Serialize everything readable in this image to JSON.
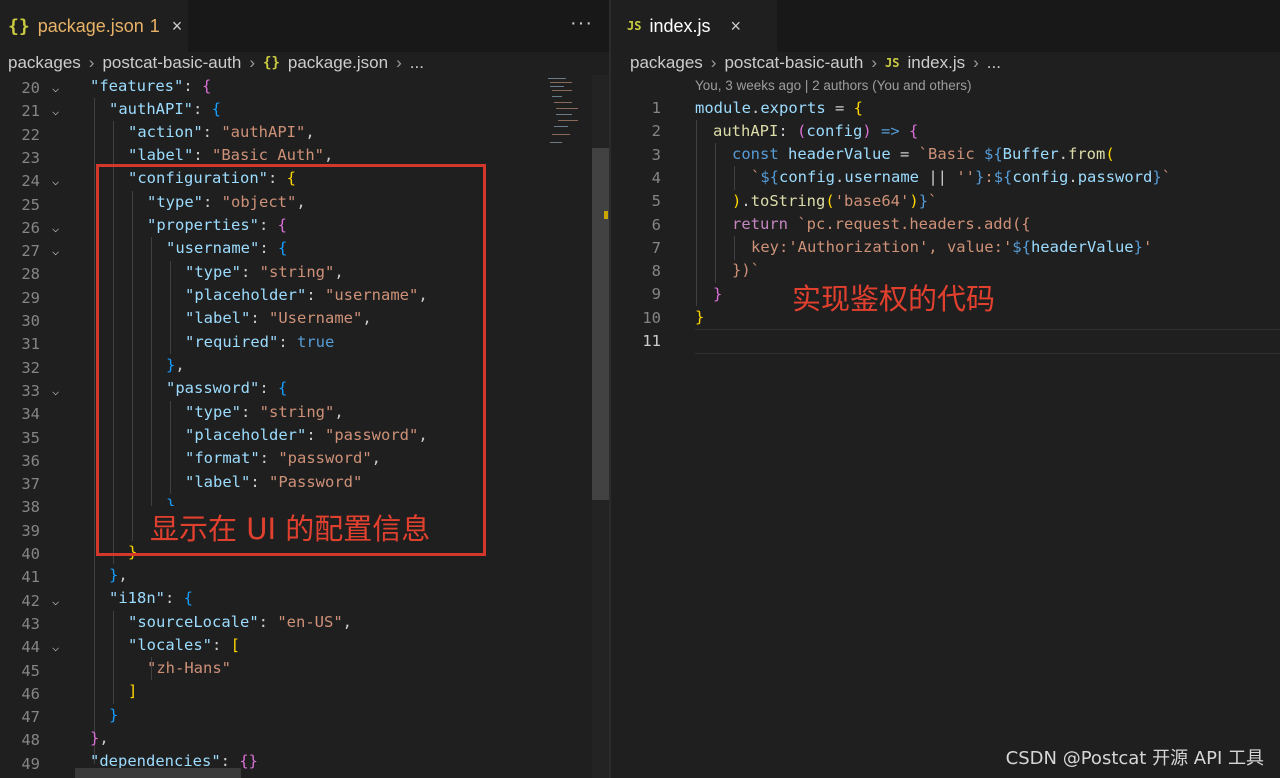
{
  "left_editor": {
    "tab": {
      "icon": "{}",
      "label": "package.json",
      "badge": "1",
      "close": "×"
    },
    "tab_actions": "···",
    "breadcrumb": [
      "packages",
      "postcat-basic-auth",
      "package.json",
      "..."
    ],
    "breadcrumb_file_icon": "{}",
    "lines": [
      {
        "num": "20",
        "fold": true
      },
      {
        "num": "21",
        "fold": true
      },
      {
        "num": "22",
        "fold": false
      },
      {
        "num": "23",
        "fold": false
      },
      {
        "num": "24",
        "fold": true
      },
      {
        "num": "25",
        "fold": false
      },
      {
        "num": "26",
        "fold": true
      },
      {
        "num": "27",
        "fold": true
      },
      {
        "num": "28",
        "fold": false
      },
      {
        "num": "29",
        "fold": false
      },
      {
        "num": "30",
        "fold": false
      },
      {
        "num": "31",
        "fold": false
      },
      {
        "num": "32",
        "fold": false
      },
      {
        "num": "33",
        "fold": true
      },
      {
        "num": "34",
        "fold": false
      },
      {
        "num": "35",
        "fold": false
      },
      {
        "num": "36",
        "fold": false
      },
      {
        "num": "37",
        "fold": false
      },
      {
        "num": "38",
        "fold": false
      },
      {
        "num": "39",
        "fold": false
      },
      {
        "num": "40",
        "fold": false
      },
      {
        "num": "41",
        "fold": false
      },
      {
        "num": "42",
        "fold": true
      },
      {
        "num": "43",
        "fold": false
      },
      {
        "num": "44",
        "fold": true
      },
      {
        "num": "45",
        "fold": false
      },
      {
        "num": "46",
        "fold": false
      },
      {
        "num": "47",
        "fold": false
      },
      {
        "num": "48",
        "fold": false
      },
      {
        "num": "49",
        "fold": false
      }
    ],
    "annotation": "显示在 UI 的配置信息"
  },
  "right_editor": {
    "tab": {
      "icon": "JS",
      "label": "index.js",
      "close": "×"
    },
    "breadcrumb": [
      "packages",
      "postcat-basic-auth",
      "index.js",
      "..."
    ],
    "breadcrumb_file_icon": "JS",
    "blame": "You, 3 weeks ago | 2 authors (You and others)",
    "line_numbers": [
      "1",
      "2",
      "3",
      "4",
      "5",
      "6",
      "7",
      "8",
      "9",
      "10",
      "11"
    ],
    "annotation": "实现鉴权的代码"
  },
  "watermark": "CSDN @Postcat 开源 API 工具",
  "colors": {
    "background": "#1f1f1f",
    "json_key": "#9cdcfe",
    "string": "#ce9178",
    "annotation_red": "#d4382b"
  }
}
